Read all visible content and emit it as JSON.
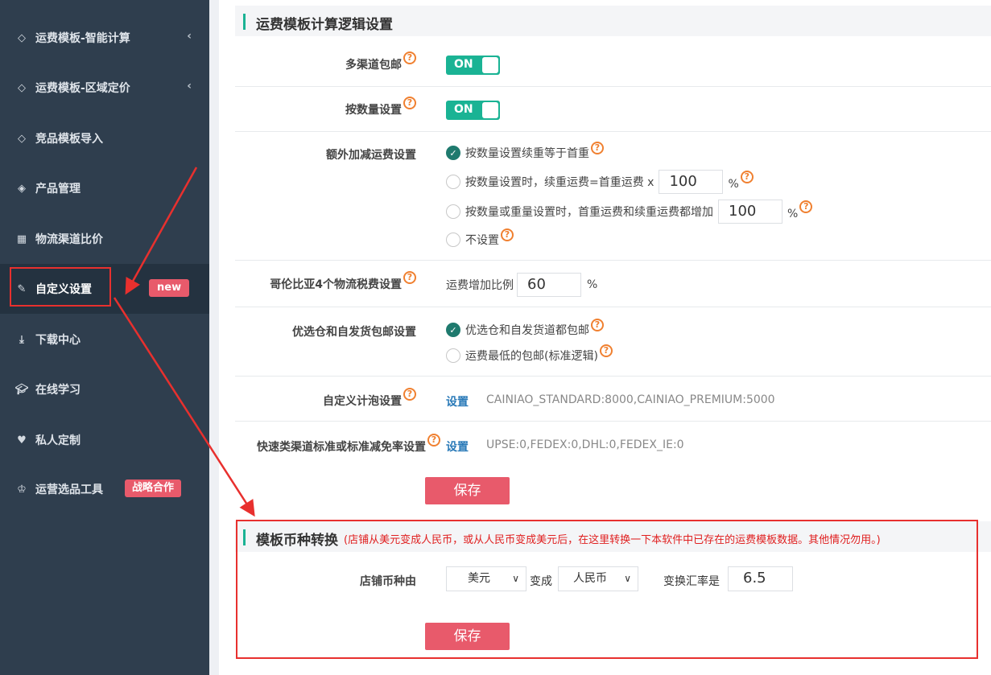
{
  "sidebar": {
    "items": [
      {
        "label": "运费模板-智能计算",
        "icon": "diamond-icon",
        "arrow": "‹"
      },
      {
        "label": "运费模板-区域定价",
        "icon": "diamond-icon",
        "arrow": "‹"
      },
      {
        "label": "竞品模板导入",
        "icon": "diamond-icon"
      },
      {
        "label": "产品管理",
        "icon": "cube-icon"
      },
      {
        "label": "物流渠道比价",
        "icon": "calculator-icon"
      },
      {
        "label": "自定义设置",
        "icon": "wrench-icon",
        "badge": "new"
      },
      {
        "label": "下载中心",
        "icon": "download-icon"
      },
      {
        "label": "在线学习",
        "icon": "graduation-cap-icon"
      },
      {
        "label": "私人定制",
        "icon": "heart-icon"
      },
      {
        "label": "运营选品工具",
        "icon": "trophy-icon",
        "badge": "战略合作"
      }
    ]
  },
  "logic": {
    "title": "运费模板计算逻辑设置",
    "multi_channel": {
      "label": "多渠道包邮",
      "toggle": "ON"
    },
    "by_quantity": {
      "label": "按数量设置",
      "toggle": "ON"
    },
    "extra": {
      "label": "额外加减运费设置",
      "options": [
        {
          "prefix": "按数量设置续重等于首重",
          "selected": true
        },
        {
          "prefix": "按数量设置时，续重运费=首重运费 x",
          "value": "100",
          "suffix": "%"
        },
        {
          "prefix": "按数量或重量设置时，首重运费和续重运费都增加",
          "value": "100",
          "suffix": "%"
        },
        {
          "prefix": "不设置"
        }
      ]
    },
    "colombia": {
      "label": "哥伦比亚4个物流税费设置",
      "text": "运费增加比例",
      "value": "60",
      "suffix": "%"
    },
    "warehouse": {
      "label": "优选仓和自发货包邮设置",
      "options": [
        {
          "text": "优选仓和自发货道都包邮",
          "selected": true
        },
        {
          "text": "运费最低的包邮(标准逻辑)"
        }
      ]
    },
    "bubble": {
      "label": "自定义计泡设置",
      "link": "设置",
      "value": "CAINIAO_STANDARD:8000,CAINIAO_PREMIUM:5000"
    },
    "express": {
      "label": "快速类渠道标准或标准减免率设置",
      "link": "设置",
      "value": "UPSE:0,FEDEX:0,DHL:0,FEDEX_IE:0"
    },
    "save": "保存"
  },
  "currency": {
    "title": "模板币种转换",
    "note": "(店铺从美元变成人民币，或从人民币变成美元后，在这里转换一下本软件中已存在的运费模板数据。其他情况勿用。)",
    "label": "店铺币种由",
    "from": "美元",
    "to_label": "变成",
    "to": "人民币",
    "rate_label": "变换汇率是",
    "rate": "6.5",
    "save": "保存"
  },
  "colors": {
    "accent": "#1ab394",
    "danger": "#e85a6b",
    "sidebar": "#2f3e4e",
    "annotation": "#e8302e"
  }
}
